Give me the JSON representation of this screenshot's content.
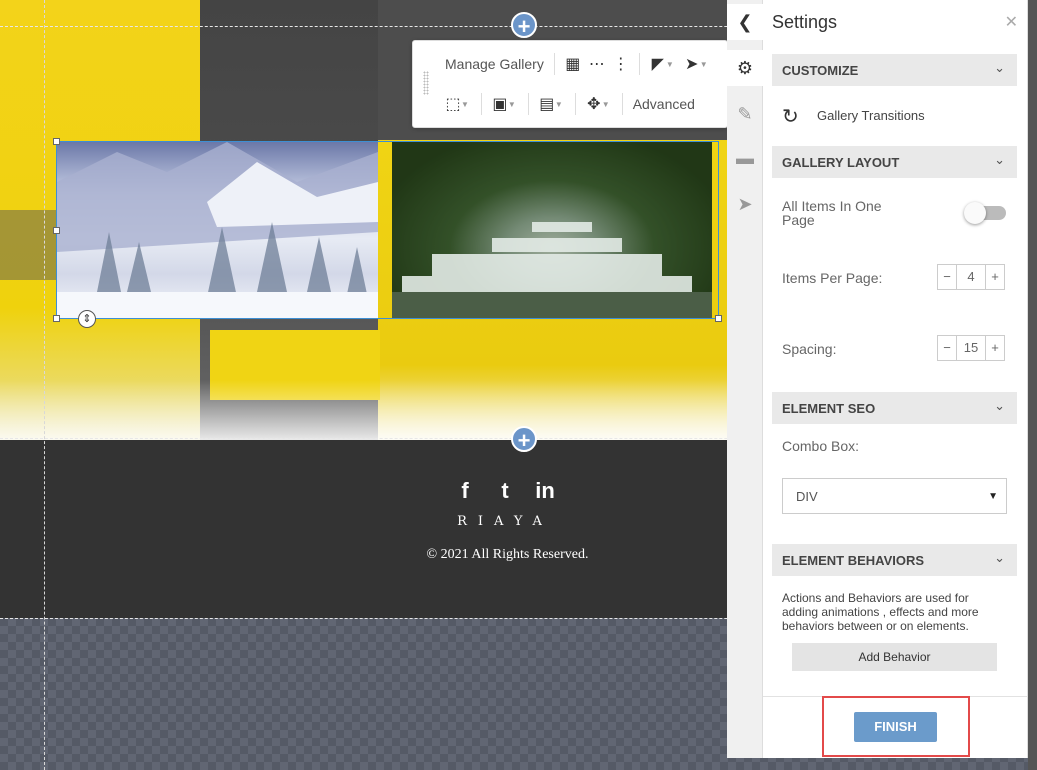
{
  "toolbar": {
    "manage_gallery": "Manage Gallery",
    "advanced": "Advanced"
  },
  "footer": {
    "social": [
      "f",
      "t",
      "in"
    ],
    "brand": "RIAYA",
    "copyright": "© 2021 All Rights Reserved."
  },
  "panel": {
    "title": "Settings",
    "sections": {
      "customize": "CUSTOMIZE",
      "gallery_layout": "GALLERY LAYOUT",
      "element_seo": "ELEMENT SEO",
      "element_behaviors": "ELEMENT BEHAVIORS"
    },
    "gallery_transitions": "Gallery Transitions",
    "all_items_label": "All Items In One Page",
    "all_items_on": false,
    "items_per_page_label": "Items Per Page:",
    "items_per_page": "4",
    "spacing_label": "Spacing:",
    "spacing": "15",
    "combo_label": "Combo Box:",
    "combo_value": "DIV",
    "behaviors_desc": "Actions and Behaviors are used for adding animations , effects and more behaviors between or on elements.",
    "add_behavior": "Add Behavior",
    "finish": "FINISH"
  },
  "colors": {
    "accent": "#6b9bcb",
    "highlight": "#e34a4a",
    "footer_bg": "#333333"
  },
  "icons": {
    "toolbar_row1": [
      "grid-icon",
      "dots-horizontal-icon",
      "dots-vertical-icon",
      "paint-bucket-icon",
      "rocket-icon"
    ],
    "toolbar_row2": [
      "selection-icon",
      "fill-icon",
      "image-icon",
      "move-icon"
    ],
    "sidenav": [
      "chevron-left-icon",
      "gear-icon",
      "brush-icon",
      "ruler-icon",
      "rocket-icon"
    ]
  }
}
